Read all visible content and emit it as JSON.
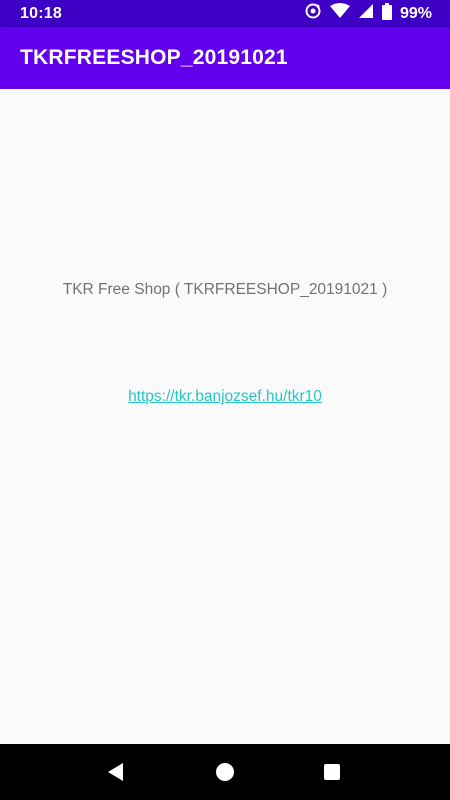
{
  "status_bar": {
    "time": "10:18",
    "battery": "99%",
    "icons": [
      "sync-icon",
      "wifi-icon",
      "signal-icon",
      "battery-icon"
    ]
  },
  "app_bar": {
    "title": "TKRFREESHOP_20191021",
    "color": "#6200ee"
  },
  "content": {
    "shop_title": "TKR Free Shop ( TKRFREESHOP_20191021 )",
    "link_text": "https://tkr.banjozsef.hu/tkr10",
    "link_color": "#26c6c6"
  },
  "nav_bar": {
    "icons": [
      "back-icon",
      "home-icon",
      "recents-icon"
    ]
  }
}
